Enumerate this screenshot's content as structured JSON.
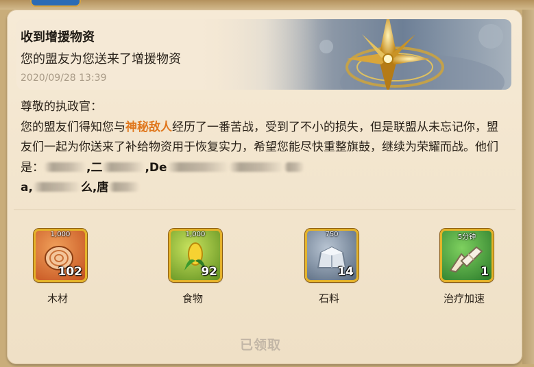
{
  "mail": {
    "title": "收到增援物资",
    "subtitle": "您的盟友为您送来了增援物资",
    "date": "2020/09/28 13:39"
  },
  "body": {
    "greeting": "尊敬的执政官：",
    "text_before": "您的盟友们得知您与",
    "highlight": "神秘敌人",
    "text_after": "经历了一番苦战，受到了不小的损失，但是联盟从未忘记你，盟友们一起为你送来了补给物资用于恢复实力，希望您能尽快重整旗鼓，继续为荣耀而战。他们是：",
    "names": [
      {
        "visible": ""
      },
      {
        "visible": ",二"
      },
      {
        "visible": ",De"
      },
      {
        "visible": ""
      },
      {
        "visible": ""
      },
      {
        "visible": "a,"
      },
      {
        "visible": "么,唐"
      }
    ]
  },
  "rewards": [
    {
      "label": "木材",
      "cap": "1,000",
      "count": "102",
      "icon": "wood-log-icon",
      "bg": "#d8642b"
    },
    {
      "label": "食物",
      "cap": "1,000",
      "count": "92",
      "icon": "corn-icon",
      "bg": "#8fb82d"
    },
    {
      "label": "石料",
      "cap": "750",
      "count": "14",
      "icon": "stone-icon",
      "bg": "#7f8fa3"
    },
    {
      "label": "治疗加速",
      "cap": "5分钟",
      "count": "1",
      "icon": "bandage-speedup-icon",
      "bg": "#3f9a3a"
    }
  ],
  "footer": {
    "claimed_label": "已领取"
  }
}
